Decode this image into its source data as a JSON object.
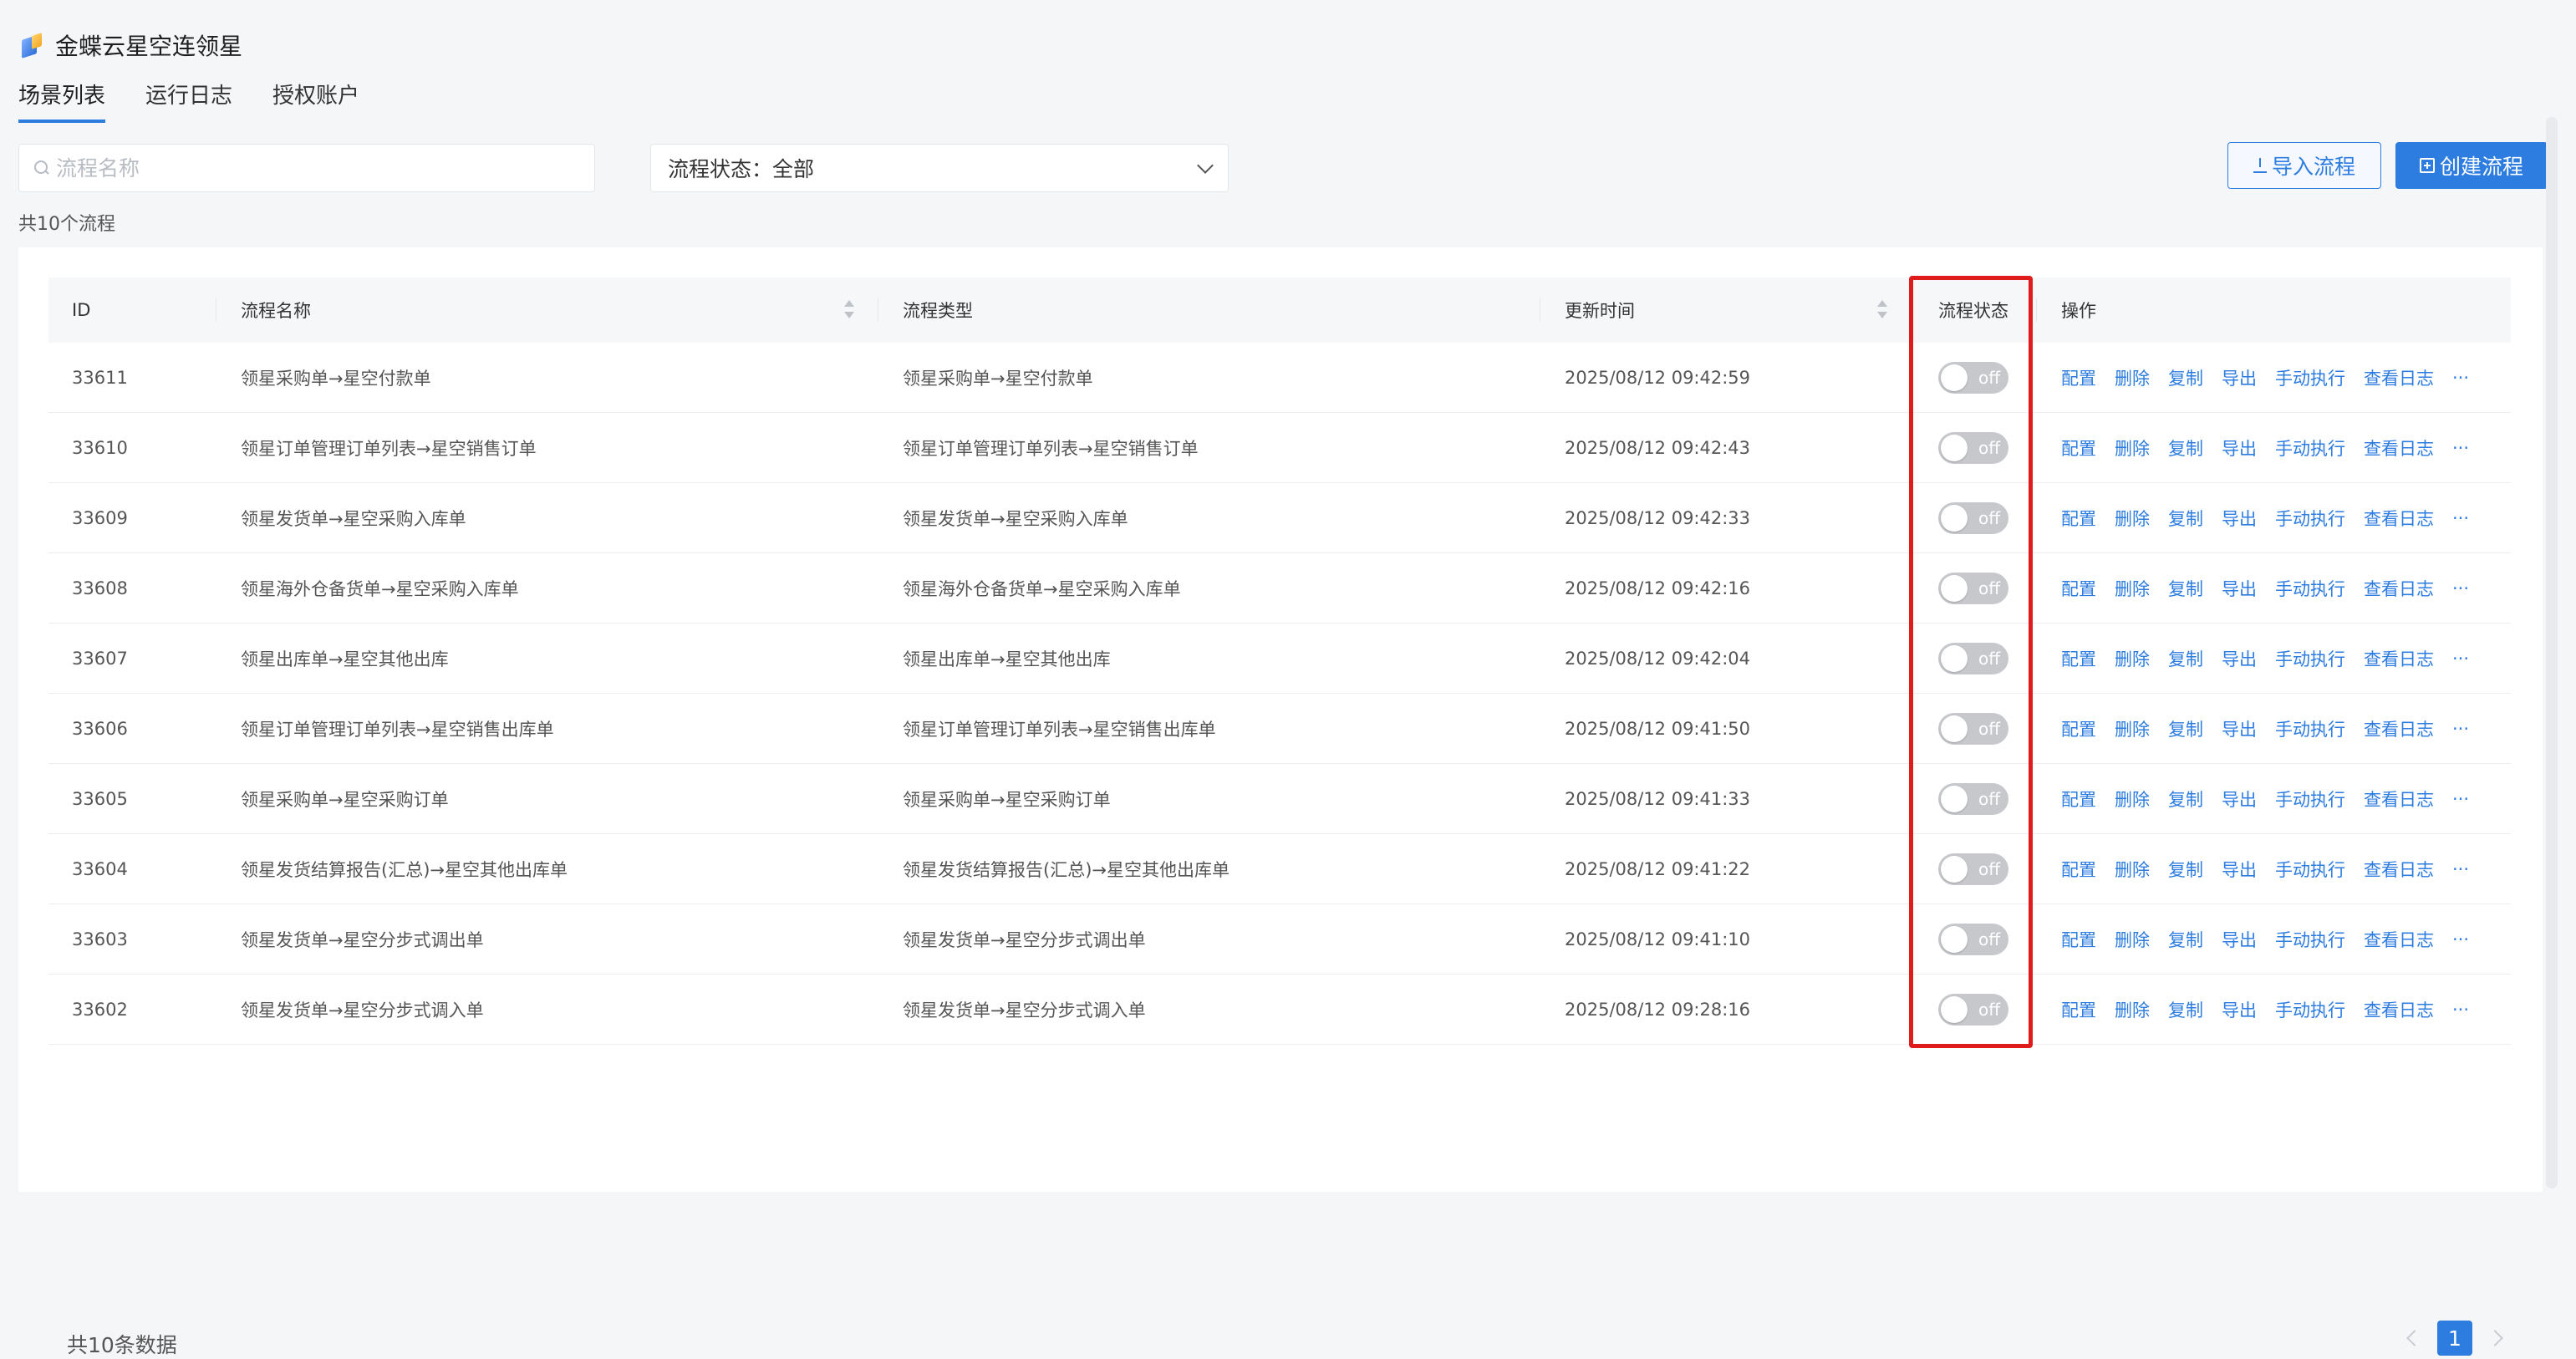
{
  "app": {
    "title": "金蝶云星空连领星"
  },
  "tabs": [
    {
      "label": "场景列表",
      "active": true
    },
    {
      "label": "运行日志",
      "active": false
    },
    {
      "label": "授权账户",
      "active": false
    }
  ],
  "filters": {
    "search_placeholder": "流程名称",
    "status_label": "流程状态：全部"
  },
  "actions": {
    "import_label": "导入流程",
    "create_label": "创建流程"
  },
  "summary": {
    "flow_count": "共10个流程",
    "total": "共10条数据"
  },
  "table": {
    "headers": [
      "ID",
      "流程名称",
      "流程类型",
      "更新时间",
      "流程状态",
      "操作"
    ],
    "ops": [
      "配置",
      "删除",
      "复制",
      "导出",
      "手动执行",
      "查看日志",
      "···"
    ],
    "toggle_label": "off",
    "rows": [
      {
        "id": "33611",
        "name": "领星采购单→星空付款单",
        "type": "领星采购单→星空付款单",
        "time": "2025/08/12 09:42:59",
        "status": "off"
      },
      {
        "id": "33610",
        "name": "领星订单管理订单列表→星空销售订单",
        "type": "领星订单管理订单列表→星空销售订单",
        "time": "2025/08/12 09:42:43",
        "status": "off"
      },
      {
        "id": "33609",
        "name": "领星发货单→星空采购入库单",
        "type": "领星发货单→星空采购入库单",
        "time": "2025/08/12 09:42:33",
        "status": "off"
      },
      {
        "id": "33608",
        "name": "领星海外仓备货单→星空采购入库单",
        "type": "领星海外仓备货单→星空采购入库单",
        "time": "2025/08/12 09:42:16",
        "status": "off"
      },
      {
        "id": "33607",
        "name": "领星出库单→星空其他出库",
        "type": "领星出库单→星空其他出库",
        "time": "2025/08/12 09:42:04",
        "status": "off"
      },
      {
        "id": "33606",
        "name": "领星订单管理订单列表→星空销售出库单",
        "type": "领星订单管理订单列表→星空销售出库单",
        "time": "2025/08/12 09:41:50",
        "status": "off"
      },
      {
        "id": "33605",
        "name": "领星采购单→星空采购订单",
        "type": "领星采购单→星空采购订单",
        "time": "2025/08/12 09:41:33",
        "status": "off"
      },
      {
        "id": "33604",
        "name": "领星发货结算报告(汇总)→星空其他出库单",
        "type": "领星发货结算报告(汇总)→星空其他出库单",
        "time": "2025/08/12 09:41:22",
        "status": "off"
      },
      {
        "id": "33603",
        "name": "领星发货单→星空分步式调出单",
        "type": "领星发货单→星空分步式调出单",
        "time": "2025/08/12 09:41:10",
        "status": "off"
      },
      {
        "id": "33602",
        "name": "领星发货单→星空分步式调入单",
        "type": "领星发货单→星空分步式调入单",
        "time": "2025/08/12 09:28:16",
        "status": "off"
      }
    ]
  },
  "pagination": {
    "current": "1"
  },
  "colors": {
    "accent": "#2d7ce0",
    "highlight": "#e01b1b",
    "toggle_off": "#c6c8cc"
  }
}
